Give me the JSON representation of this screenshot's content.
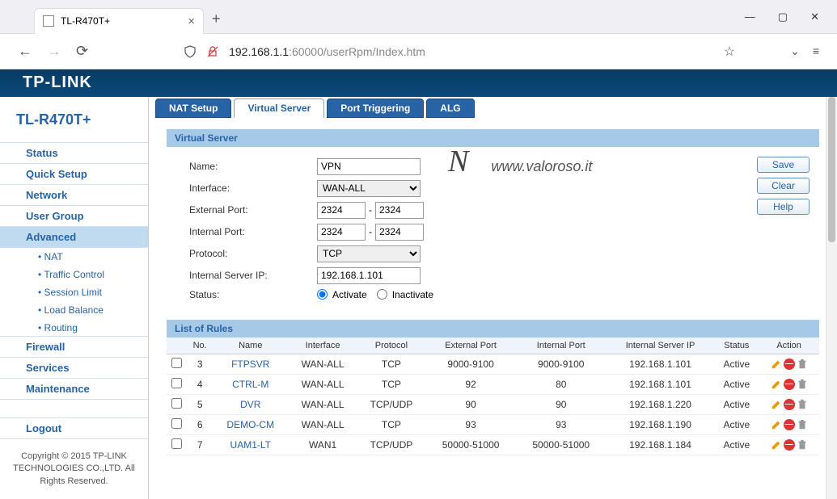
{
  "browser": {
    "tab_title": "TL-R470T+",
    "url_host": "192.168.1.1",
    "url_path": ":60000/userRpm/Index.htm"
  },
  "brand": "TP-LINK",
  "model": "TL-R470T+",
  "sidebar": {
    "items": [
      "Status",
      "Quick Setup",
      "Network",
      "User Group",
      "Advanced"
    ],
    "advanced_sub": [
      "NAT",
      "Traffic Control",
      "Session Limit",
      "Load Balance",
      "Routing"
    ],
    "items2": [
      "Firewall",
      "Services",
      "Maintenance"
    ],
    "logout": "Logout",
    "copyright": "Copyright © 2015 TP-LINK TECHNOLOGIES CO.,LTD. All Rights Reserved."
  },
  "tabs": [
    "NAT Setup",
    "Virtual Server",
    "Port Triggering",
    "ALG"
  ],
  "panel_title": "Virtual Server",
  "form": {
    "name_label": "Name:",
    "name_value": "VPN",
    "interface_label": "Interface:",
    "interface_value": "WAN-ALL",
    "ext_port_label": "External Port:",
    "ext_port_from": "2324",
    "ext_port_to": "2324",
    "int_port_label": "Internal Port:",
    "int_port_from": "2324",
    "int_port_to": "2324",
    "protocol_label": "Protocol:",
    "protocol_value": "TCP",
    "server_ip_label": "Internal Server IP:",
    "server_ip_value": "192.168.1.101",
    "status_label": "Status:",
    "status_activate": "Activate",
    "status_inactivate": "Inactivate"
  },
  "buttons": {
    "save": "Save",
    "clear": "Clear",
    "help": "Help"
  },
  "watermark": "www.valoroso.it",
  "rules_title": "List of Rules",
  "rules_headers": [
    "",
    "No.",
    "Name",
    "Interface",
    "Protocol",
    "External Port",
    "Internal Port",
    "Internal Server IP",
    "Status",
    "Action"
  ],
  "rules": [
    {
      "no": "3",
      "name": "FTPSVR",
      "iface": "WAN-ALL",
      "proto": "TCP",
      "ext": "9000-9100",
      "int": "9000-9100",
      "ip": "192.168.1.101",
      "status": "Active"
    },
    {
      "no": "4",
      "name": "CTRL-M",
      "iface": "WAN-ALL",
      "proto": "TCP",
      "ext": "92",
      "int": "80",
      "ip": "192.168.1.101",
      "status": "Active"
    },
    {
      "no": "5",
      "name": "DVR",
      "iface": "WAN-ALL",
      "proto": "TCP/UDP",
      "ext": "90",
      "int": "90",
      "ip": "192.168.1.220",
      "status": "Active"
    },
    {
      "no": "6",
      "name": "DEMO-CM",
      "iface": "WAN-ALL",
      "proto": "TCP",
      "ext": "93",
      "int": "93",
      "ip": "192.168.1.190",
      "status": "Active"
    },
    {
      "no": "7",
      "name": "UAM1-LT",
      "iface": "WAN1",
      "proto": "TCP/UDP",
      "ext": "50000-51000",
      "int": "50000-51000",
      "ip": "192.168.1.184",
      "status": "Active"
    }
  ]
}
